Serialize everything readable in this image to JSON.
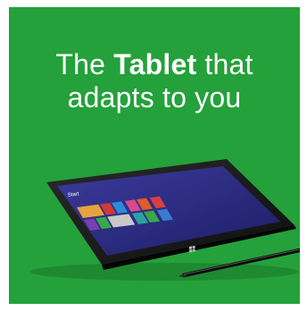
{
  "ad": {
    "headline_pre": "The",
    "headline_bold": "Tablet",
    "headline_post": "that",
    "headline_line2": "adapts to you"
  },
  "tablet_screen": {
    "start_label": "Start"
  },
  "colors": {
    "panel_green": "#24a13a",
    "text_white": "#ffffff",
    "tablet_body": "#1a1a1a",
    "screen_bg": "#2a2a82"
  },
  "icons": [
    "windows-logo-icon",
    "stylus-pen"
  ]
}
